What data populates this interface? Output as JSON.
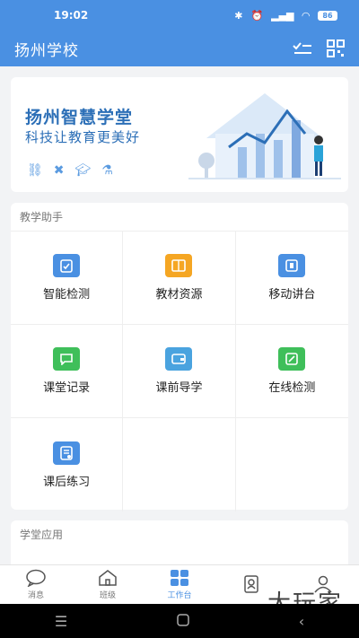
{
  "status_bar": {
    "time": "19:02",
    "battery": "86"
  },
  "app_bar": {
    "title": "扬州学校"
  },
  "banner": {
    "title": "扬州智慧学堂",
    "subtitle": "科技让教育更美好"
  },
  "section1": {
    "title": "教学助手",
    "items": [
      {
        "label": "智能检测",
        "color": "#4a90e2"
      },
      {
        "label": "教材资源",
        "color": "#f5a623"
      },
      {
        "label": "移动讲台",
        "color": "#4a90e2"
      },
      {
        "label": "课堂记录",
        "color": "#3fbf5a"
      },
      {
        "label": "课前导学",
        "color": "#4aa3df"
      },
      {
        "label": "在线检测",
        "color": "#3fbf5a"
      },
      {
        "label": "课后练习",
        "color": "#4a90e2"
      }
    ]
  },
  "section2": {
    "title": "学堂应用"
  },
  "tabs": [
    {
      "label": "消息",
      "icon": "chat-icon"
    },
    {
      "label": "班级",
      "icon": "house-icon"
    },
    {
      "label": "工作台",
      "icon": "grid-icon",
      "active": true
    },
    {
      "label": "",
      "icon": "contacts-icon"
    },
    {
      "label": "",
      "icon": "person-icon"
    }
  ],
  "watermark": "大玩家",
  "colors": {
    "primary": "#4a90e2",
    "background": "#f2f3f5"
  }
}
